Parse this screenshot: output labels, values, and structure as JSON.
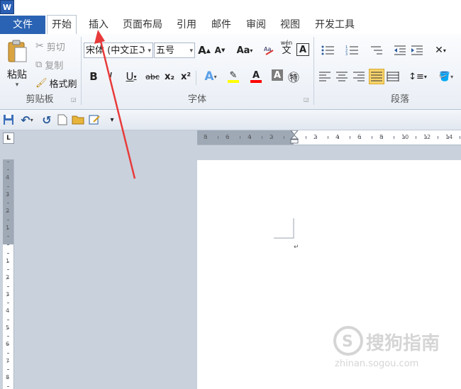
{
  "app": {
    "icon_letter": "W"
  },
  "tabs": [
    {
      "id": "file",
      "label": "文件"
    },
    {
      "id": "home",
      "label": "开始"
    },
    {
      "id": "insert",
      "label": "插入"
    },
    {
      "id": "layout",
      "label": "页面布局"
    },
    {
      "id": "references",
      "label": "引用"
    },
    {
      "id": "mailings",
      "label": "邮件"
    },
    {
      "id": "review",
      "label": "审阅"
    },
    {
      "id": "view",
      "label": "视图"
    },
    {
      "id": "developer",
      "label": "开发工具"
    }
  ],
  "clipboard": {
    "paste": "粘贴",
    "cut": "剪切",
    "copy": "复制",
    "format_painter": "格式刷",
    "group_label": "剪贴板"
  },
  "font": {
    "font_name": "宋体 (中文正ℑ",
    "font_size": "五号",
    "grow": "A",
    "shrink": "A",
    "change_case": "Aa",
    "phonetic": "wén",
    "char_border": "A",
    "bold": "B",
    "italic": "I",
    "underline": "U",
    "strike": "abc",
    "subscript": "x₂",
    "superscript": "x²",
    "text_effect": "A",
    "highlight": "✎",
    "font_color": "A",
    "char_shading": "A",
    "enclose": "㊕",
    "group_label": "字体"
  },
  "paragraph": {
    "group_label": "段落"
  },
  "quick_access": {
    "save": "💾",
    "undo": "↶",
    "redo": "↺",
    "new": "🗋",
    "open": "📂",
    "customize": "▾"
  },
  "ruler": {
    "corner": "L",
    "h_numbers": [
      "8",
      "6",
      "4",
      "2",
      "2",
      "4",
      "6",
      "8",
      "10",
      "12",
      "14"
    ],
    "v_numbers": [
      "4",
      "3",
      "2",
      "1",
      "1",
      "2",
      "3",
      "4",
      "5",
      "6",
      "7",
      "8"
    ]
  },
  "document": {
    "paragraph_mark": "↵"
  },
  "colors": {
    "file_tab": "#2a63b3",
    "highlight_yellow": "#ffff00",
    "font_color_red": "#ff0000",
    "arrow_red": "#e83a3a"
  },
  "watermark": {
    "text": "搜狗指南",
    "url": "zhinan.sogou.com"
  }
}
